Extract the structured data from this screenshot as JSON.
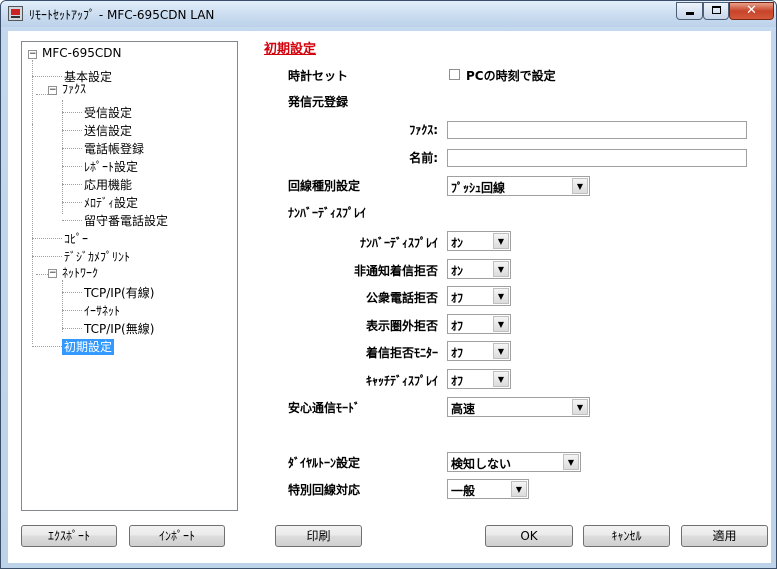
{
  "window": {
    "title": "ﾘﾓｰﾄｾｯﾄｱｯﾌﾟ - MFC-695CDN LAN"
  },
  "tree": {
    "root": "MFC-695CDN",
    "items": [
      {
        "label": "基本設定"
      },
      {
        "label": "ﾌｧｸｽ"
      },
      {
        "label": "受信設定"
      },
      {
        "label": "送信設定"
      },
      {
        "label": "電話帳登録"
      },
      {
        "label": "ﾚﾎﾟｰﾄ設定"
      },
      {
        "label": "応用機能"
      },
      {
        "label": "ﾒﾛﾃﾞｨ設定"
      },
      {
        "label": "留守番電話設定"
      },
      {
        "label": "ｺﾋﾟｰ"
      },
      {
        "label": "ﾃﾞｼﾞｶﾒﾌﾟﾘﾝﾄ"
      },
      {
        "label": "ﾈｯﾄﾜｰｸ"
      },
      {
        "label": "TCP/IP(有線)"
      },
      {
        "label": "ｲｰｻﾈｯﾄ"
      },
      {
        "label": "TCP/IP(無線)"
      },
      {
        "label": "初期設定"
      }
    ]
  },
  "main": {
    "section_title": "初期設定",
    "clock_label": "時計セット",
    "clock_check_label": "PCの時刻で設定",
    "sender_label": "発信元登録",
    "fax_label": "ﾌｧｸｽ:",
    "fax_value": "",
    "name_label": "名前:",
    "name_value": "",
    "line_type_label": "回線種別設定",
    "line_type_value": "ﾌﾟｯｼｭ回線",
    "number_display_section": "ﾅﾝﾊﾞｰﾃﾞｨｽﾌﾟﾚｲ",
    "rows": [
      {
        "label": "ﾅﾝﾊﾞｰﾃﾞｨｽﾌﾟﾚｲ",
        "value": "ｵﾝ"
      },
      {
        "label": "非通知着信拒否",
        "value": "ｵﾝ"
      },
      {
        "label": "公衆電話拒否",
        "value": "ｵﾌ"
      },
      {
        "label": "表示圏外拒否",
        "value": "ｵﾌ"
      },
      {
        "label": "着信拒否ﾓﾆﾀｰ",
        "value": "ｵﾌ"
      },
      {
        "label": "ｷｬｯﾁﾃﾞｨｽﾌﾟﾚｲ",
        "value": "ｵﾌ"
      }
    ],
    "secure_label": "安心通信ﾓｰﾄﾞ",
    "secure_value": "高速",
    "dialtone_label": "ﾀﾞｲﾔﾙﾄｰﾝ設定",
    "dialtone_value": "検知しない",
    "special_line_label": "特別回線対応",
    "special_line_value": "一般"
  },
  "buttons": {
    "export": "ｴｸｽﾎﾟｰﾄ",
    "import": "ｲﾝﾎﾟｰﾄ",
    "print": "印刷",
    "ok": "OK",
    "cancel": "ｷｬﾝｾﾙ",
    "apply": "適用"
  },
  "colors": {
    "section_title": "#d4000b",
    "selection": "#3399ff"
  }
}
